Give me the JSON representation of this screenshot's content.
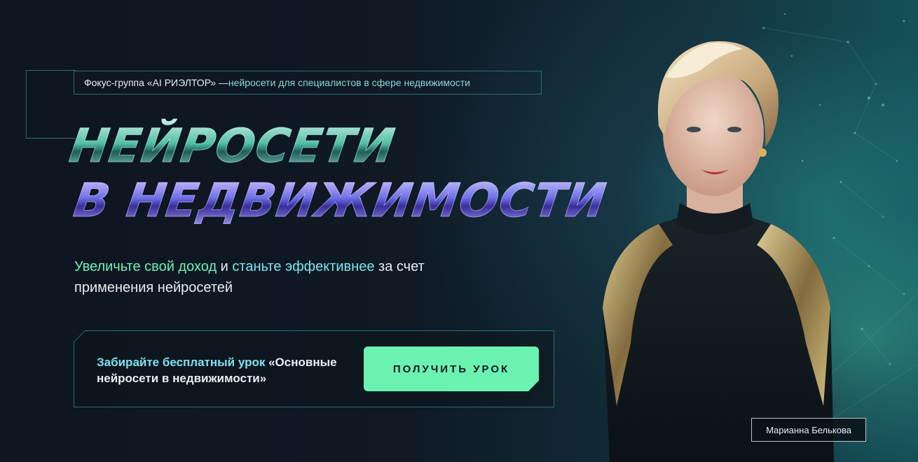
{
  "tagline": {
    "part1": "Фокус-группа «AI РИЭЛТОР» —",
    "part2": " нейросети для специалистов в сфере недвижимости"
  },
  "headline": {
    "line1": "НЕЙРОСЕТИ",
    "line2": "В НЕДВИЖИМОСТИ"
  },
  "subtitle": {
    "highlight1": "Увеличьте свой доход",
    "connector": " и ",
    "highlight2": "станьте эффективнее",
    "rest": " за счет применения нейросетей"
  },
  "lesson": {
    "highlight": "Забирайте бесплатный урок",
    "text": " «Основные нейросети в недвижимости»",
    "button_label": "ПОЛУЧИТЬ УРОК"
  },
  "speaker": {
    "name": "Марианна Белькова"
  },
  "colors": {
    "background": "#0e1722",
    "accent_green": "#6cf2b0",
    "accent_cyan": "#7fe3ee",
    "frame": "#2f6e6c"
  }
}
